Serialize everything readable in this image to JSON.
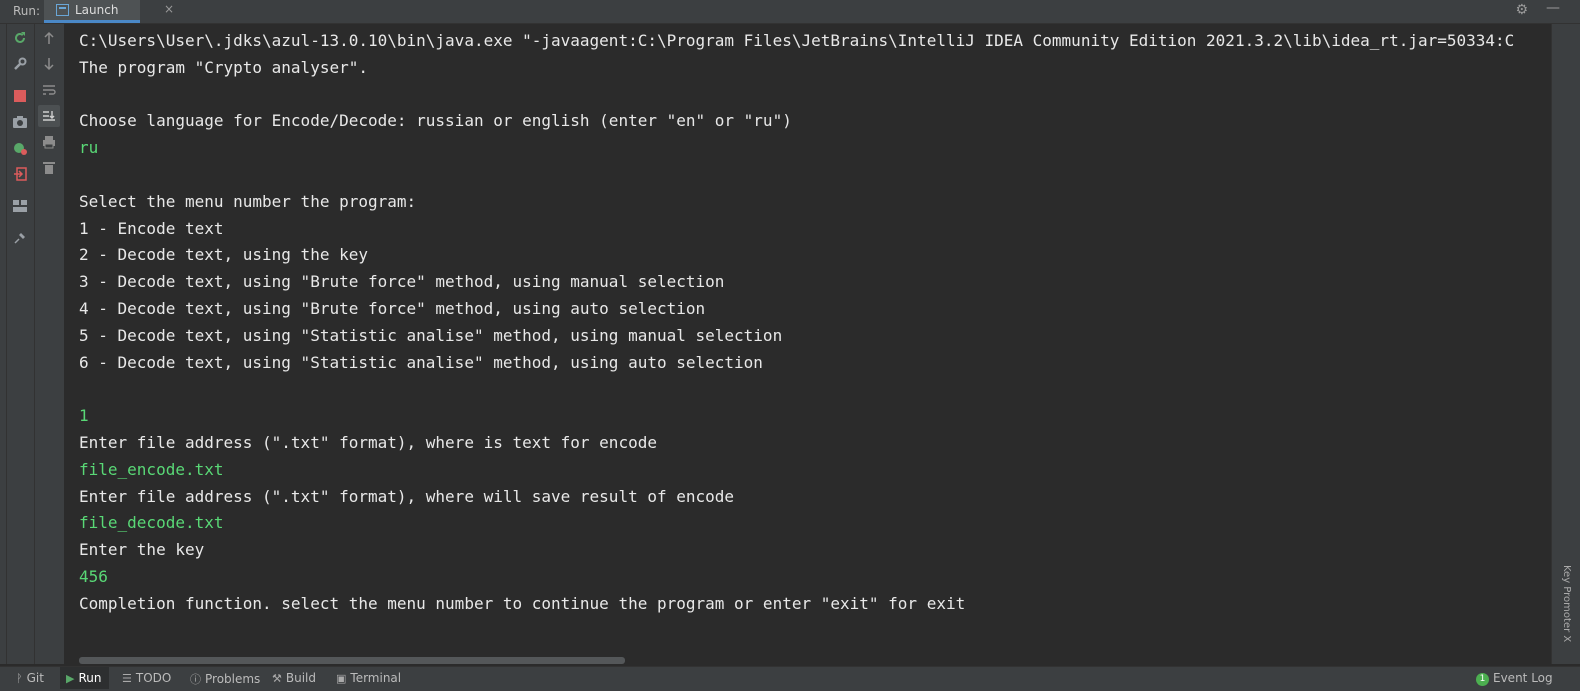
{
  "run_bar": {
    "label": "Run:",
    "tab_label": "Launch",
    "close_glyph": "×"
  },
  "icons": {
    "gear": "⚙",
    "minimize": "—"
  },
  "console": {
    "lines": [
      {
        "text": "C:\\Users\\User\\.jdks\\azul-13.0.10\\bin\\java.exe \"-javaagent:C:\\Program Files\\JetBrains\\IntelliJ IDEA Community Edition 2021.3.2\\lib\\idea_rt.jar=50334:C",
        "kind": "output"
      },
      {
        "text": "The program \"Crypto analyser\".",
        "kind": "output"
      },
      {
        "text": "",
        "kind": "output"
      },
      {
        "text": "Choose language for Encode/Decode: russian or english (enter \"en\" or \"ru\")",
        "kind": "output"
      },
      {
        "text": "ru",
        "kind": "input"
      },
      {
        "text": "",
        "kind": "output"
      },
      {
        "text": "Select the menu number the program:",
        "kind": "output"
      },
      {
        "text": "1 - Encode text",
        "kind": "output"
      },
      {
        "text": "2 - Decode text, using the key",
        "kind": "output"
      },
      {
        "text": "3 - Decode text, using \"Brute force\" method, using manual selection",
        "kind": "output"
      },
      {
        "text": "4 - Decode text, using \"Brute force\" method, using auto selection",
        "kind": "output"
      },
      {
        "text": "5 - Decode text, using \"Statistic analise\" method, using manual selection",
        "kind": "output"
      },
      {
        "text": "6 - Decode text, using \"Statistic analise\" method, using auto selection",
        "kind": "output"
      },
      {
        "text": "",
        "kind": "output"
      },
      {
        "text": "1",
        "kind": "input"
      },
      {
        "text": "Enter file address (\".txt\" format), where is text for encode",
        "kind": "output"
      },
      {
        "text": "file_encode.txt",
        "kind": "input"
      },
      {
        "text": "Enter file address (\".txt\" format), where will save result of encode",
        "kind": "output"
      },
      {
        "text": "file_decode.txt",
        "kind": "input"
      },
      {
        "text": "Enter the key",
        "kind": "output"
      },
      {
        "text": "456",
        "kind": "input"
      },
      {
        "text": "Completion function. select the menu number to continue the program or enter \"exit\" for exit",
        "kind": "output"
      }
    ]
  },
  "right_strip": {
    "key_promoter": "Key Promoter X"
  },
  "bottom_bar": {
    "git": "Git",
    "run": "Run",
    "todo": "TODO",
    "problems": "Problems",
    "build": "Build",
    "terminal": "Terminal",
    "event_log": "Event Log",
    "event_count": "1"
  },
  "colors": {
    "console_bg": "#2b2b2b",
    "output_text": "#e8e8e8",
    "input_text": "#59d876",
    "panel_bg": "#3c3f41",
    "accent": "#4a88c7"
  }
}
